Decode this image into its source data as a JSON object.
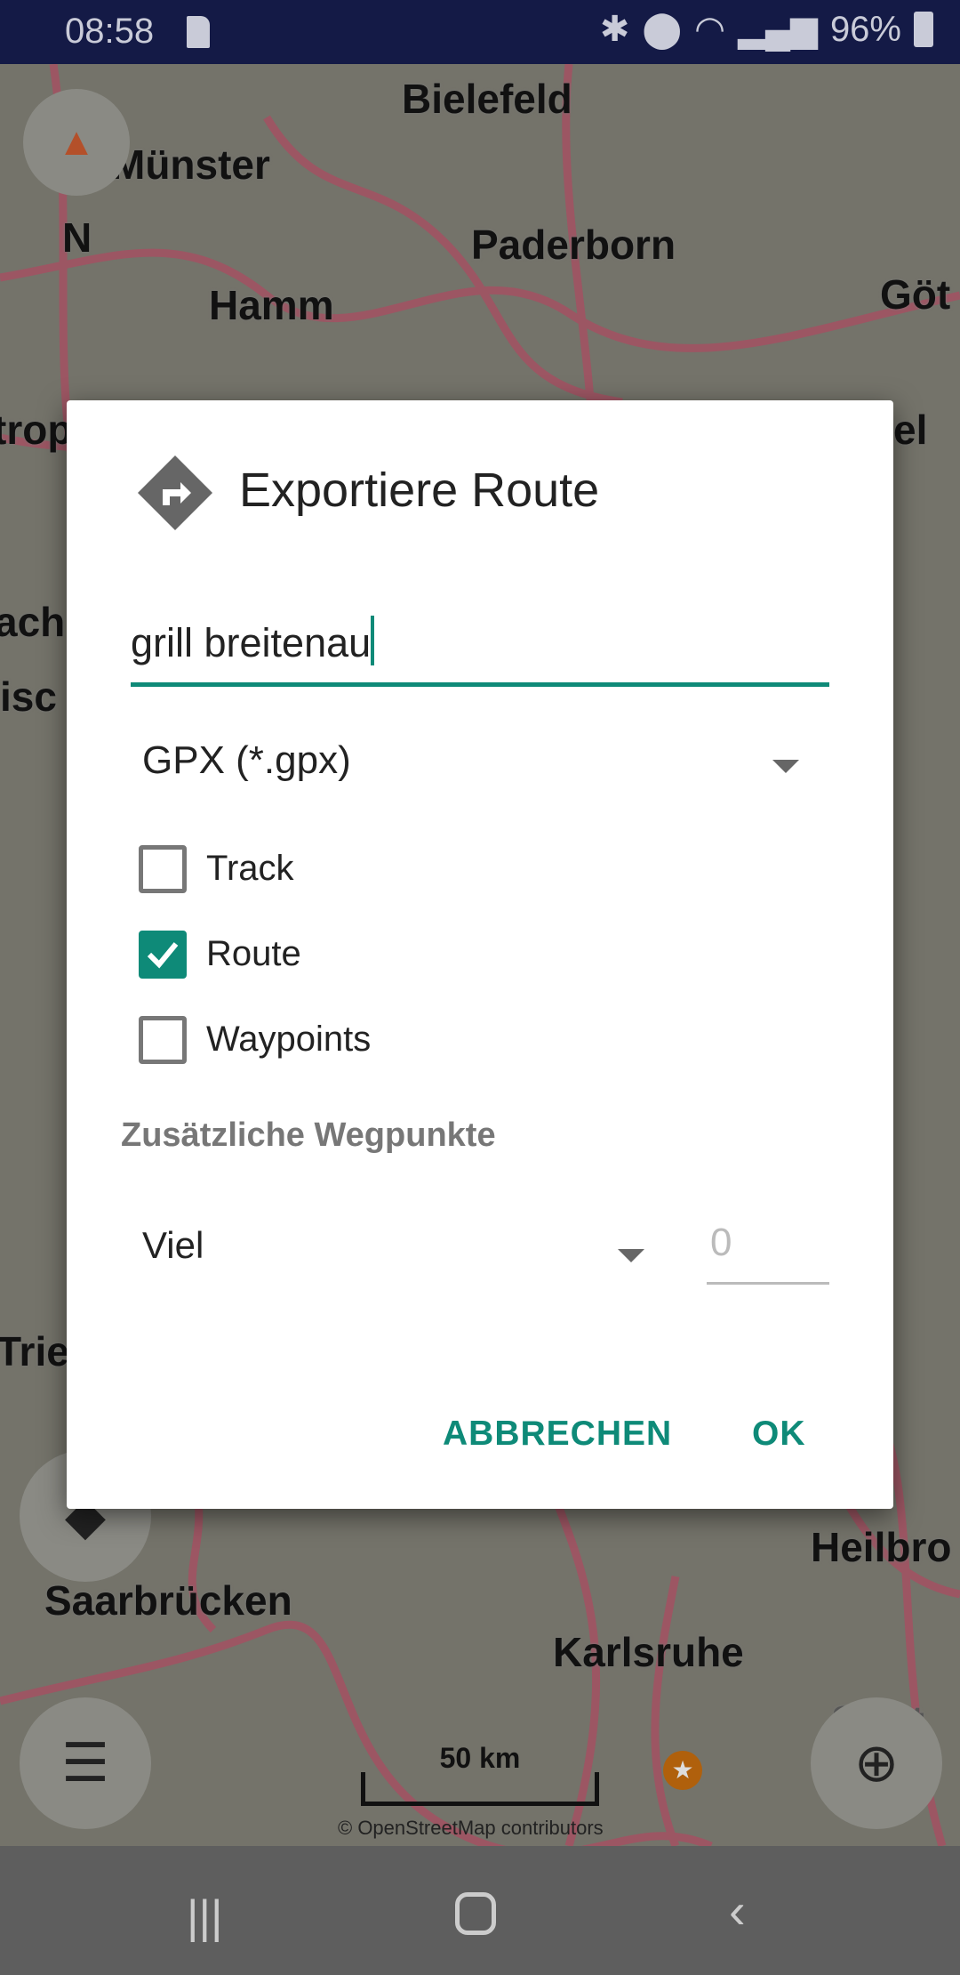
{
  "status_bar": {
    "time": "08:58",
    "battery": "96%",
    "icons": [
      "sim-settings-icon",
      "bluetooth-icon",
      "location-icon",
      "wifi-icon",
      "signal-icon",
      "battery-icon"
    ]
  },
  "map": {
    "labels": [
      "Bielefeld",
      "Münster",
      "N",
      "Paderborn",
      "Hamm",
      "Göt",
      "trop",
      "el",
      "ach",
      "isc",
      "Trie",
      "Heilbro",
      "Saarbrücken",
      "Karlsruhe",
      "Stutt"
    ],
    "scale": "50 km",
    "attribution": "© OpenStreetMap contributors",
    "colors": {
      "road": "#9c5663",
      "background": "#74736a"
    }
  },
  "dialog": {
    "title": "Exportiere Route",
    "title_icon": "directions-icon",
    "name_value": "grill breitenau",
    "format_selected": "GPX (*.gpx)",
    "checkboxes": [
      {
        "label": "Track",
        "checked": false
      },
      {
        "label": "Route",
        "checked": true
      },
      {
        "label": "Waypoints",
        "checked": false
      }
    ],
    "section_label": "Zusätzliche Wegpunkte",
    "density_selected": "Viel",
    "count_placeholder": "0",
    "cancel": "ABBRECHEN",
    "ok": "OK",
    "accent": "#0e8a78"
  }
}
